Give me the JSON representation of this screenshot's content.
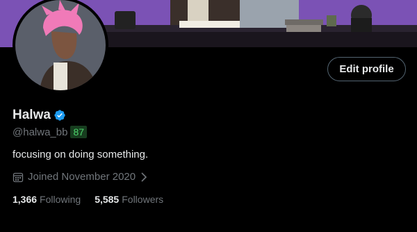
{
  "profile": {
    "display_name": "Halwa",
    "handle": "@halwa_bb",
    "score": "87",
    "bio": "focusing on doing something.",
    "joined": "Joined November 2020",
    "edit_label": "Edit profile",
    "verified_icon": "verified-badge-icon"
  },
  "stats": {
    "following_count": "1,366",
    "following_label": "Following",
    "followers_count": "5,585",
    "followers_label": "Followers"
  },
  "colors": {
    "background": "#000000",
    "banner": "#7b52b5",
    "verified": "#1d9bf0",
    "muted": "#71767b",
    "score_bg": "#173d1f",
    "score_text": "#4dd36b"
  }
}
